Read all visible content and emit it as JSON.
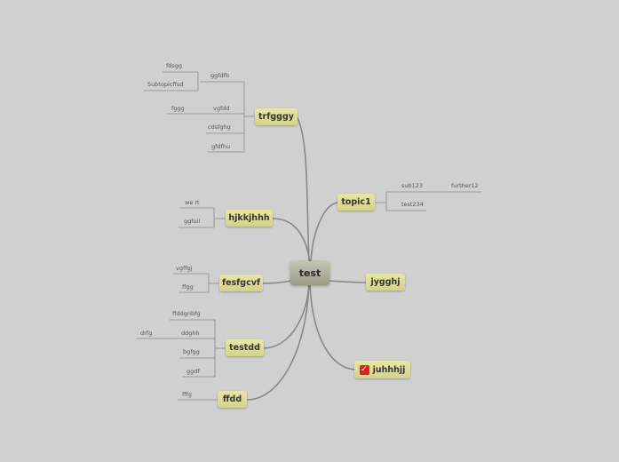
{
  "central": {
    "label": "test"
  },
  "topics": {
    "trfgggy": "trfgggy",
    "hjkkjhhh": "hjkkjhhh",
    "fesfgcvf": "fesfgcvf",
    "testdd": "testdd",
    "ffdd": "ffdd",
    "topic1": "topic1",
    "jygghj": "jygghj",
    "juhhhjj": "juhhhjj"
  },
  "subtopics": {
    "ggfdfb": "ggfdfb",
    "fdsgg": "fdsgg",
    "subtopicffsd": "Subtopicffsd",
    "vgfdd": "vgfdd",
    "fggg": "fggg",
    "cdsfghg": "cdsfghg",
    "gfdfhu": "gfdfhu",
    "wer_t": "we rt",
    "ggfuil": "ggfuil",
    "vgffgj": "vgffgj",
    "ffgg": "ffgg",
    "ffddgnbfg": "ffddgnbfg",
    "ddghh": "ddghh",
    "drfg": "drfg",
    "bgfgg": "bgfgg",
    "ggdf": "ggdf",
    "fffg": "fffg",
    "sub123": "sub123",
    "further12": "further12",
    "test234": "test234"
  },
  "colors": {
    "background": "#d0d0d0",
    "connector": "#888888",
    "leaf_line": "#8a8a8a",
    "topic_fill": "#dcdc98",
    "central_fill": "#aaaa98",
    "task_check": "#e02020"
  },
  "icons": {
    "juhhhjj": "checkbox-checked-icon"
  }
}
